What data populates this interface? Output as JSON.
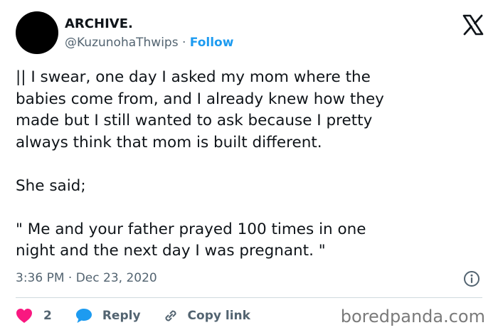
{
  "author": {
    "display_name": "ARCHIVE.",
    "handle": "@KuzunohaThwips",
    "separator": " · ",
    "follow_label": "Follow"
  },
  "tweet": {
    "text": "|| I swear, one day I asked my mom where the\nbabies come from, and I already knew how they\nmade but I still wanted to ask because I pretty\nalways think that mom is built different.\n\nShe said;\n\n\" Me and your father prayed 100 times in one\nnight and the next day I was pregnant. \"",
    "time": "3:36 PM",
    "date_separator": " · ",
    "date": "Dec 23, 2020"
  },
  "actions": {
    "like_count": "2",
    "reply_label": "Reply",
    "copy_link_label": "Copy link"
  },
  "watermark": "boredpanda.com",
  "colors": {
    "like": "#f91880",
    "reply": "#1d9bf0",
    "follow": "#1d9bf0",
    "muted": "#536471",
    "text": "#0f1419",
    "divider": "#cfd9de"
  },
  "icons": {
    "logo": "x-logo-icon",
    "info": "info-icon",
    "like": "heart-icon",
    "reply": "speech-bubble-icon",
    "copy_link": "link-icon"
  }
}
